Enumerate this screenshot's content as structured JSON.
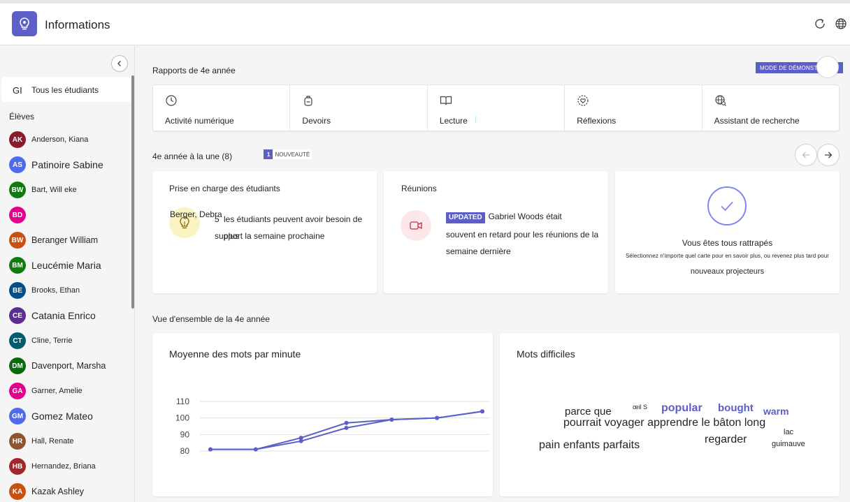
{
  "header": {
    "title": "Informations",
    "app_icon": "lightbulb-icon",
    "refresh_icon": "refresh-icon",
    "globe_icon": "globe-icon"
  },
  "sidebar": {
    "all_students": {
      "initials": "GI",
      "label": "Tous les étudiants"
    },
    "section_label": "Élèves",
    "students": [
      {
        "initials": "AK",
        "name": "Anderson, Kiana",
        "color": "#8b1a2b",
        "size": "small"
      },
      {
        "initials": "AS",
        "name": "Patinoire Sabine",
        "color": "#4f6bed",
        "size": "large"
      },
      {
        "initials": "BW",
        "name": "Bart, Will eke",
        "color": "#107c10",
        "size": "small"
      },
      {
        "initials": "BD",
        "name": "",
        "color": "#e3008c",
        "size": "small"
      },
      {
        "initials": "BW",
        "name": "Beranger William",
        "color": "#ca5010",
        "size": "medium"
      },
      {
        "initials": "BM",
        "name": "Leucémie Maria",
        "color": "#107c10",
        "size": "large"
      },
      {
        "initials": "BE",
        "name": "Brooks, Ethan",
        "color": "#004e8c",
        "size": "small"
      },
      {
        "initials": "CE",
        "name": "Catania Enrico",
        "color": "#5c2e91",
        "size": "large"
      },
      {
        "initials": "CT",
        "name": "Cline, Terrie",
        "color": "#005b70",
        "size": "small"
      },
      {
        "initials": "DM",
        "name": "Davenport, Marsha",
        "color": "#0b6a0b",
        "size": "medium"
      },
      {
        "initials": "GA",
        "name": "Garner, Amelie",
        "color": "#e3008c",
        "size": "small"
      },
      {
        "initials": "GM",
        "name": "Gomez Mateo",
        "color": "#4f6bed",
        "size": "large"
      },
      {
        "initials": "HR",
        "name": "Hall, Renate",
        "color": "#8e562e",
        "size": "small"
      },
      {
        "initials": "HB",
        "name": "Hernandez, Briana",
        "color": "#a4262c",
        "size": "small"
      },
      {
        "initials": "KA",
        "name": "Kazak Ashley",
        "color": "#ca5010",
        "size": "medium"
      }
    ]
  },
  "reports": {
    "title": "Rapports de 4e année",
    "demo_badge": "MODE DE DÉMONSTRATION",
    "items": [
      {
        "label": "Activité numérique",
        "icon": "clock-icon"
      },
      {
        "label": "Devoirs",
        "icon": "backpack-icon"
      },
      {
        "label": "Lecture",
        "icon": "book-icon"
      },
      {
        "label": "Réflexions",
        "icon": "heart-icon"
      },
      {
        "label": "Assistant de recherche",
        "icon": "globe-search-icon"
      }
    ]
  },
  "spotlight": {
    "title": "4e année à la une (8)",
    "new_count": "1",
    "new_label": "NOUVEAUTÉ",
    "cards": {
      "support": {
        "title": "Prise en charge des étudiants",
        "student": "Berger, Debra",
        "count": "5",
        "text1": "les étudiants peuvent avoir besoin de plus",
        "text2": "support la semaine prochaine"
      },
      "meetings": {
        "title": "Réunions",
        "badge": "UPDATED",
        "text1": "Gabriel Woods était",
        "text2": "souvent en retard pour les réunions de la semaine dernière"
      },
      "caught_up": {
        "title": "Vous êtes tous rattrapés",
        "sub1": "Sélectionnez n'importe quel carte pour en savoir plus, ou revenez plus tard pour",
        "sub2": "nouveaux projecteurs"
      }
    }
  },
  "overview": {
    "title": "Vue d'ensemble de la 4e année",
    "wpm_title": "Moyenne des mots par minute",
    "difficult_title": "Mots difficiles",
    "words": [
      {
        "text": "parce que",
        "size": 15,
        "color": "#242424",
        "bold": false
      },
      {
        "text": "œil S",
        "size": 9,
        "color": "#242424",
        "bold": false
      },
      {
        "text": "popular",
        "size": 16,
        "color": "#5b5fc7",
        "bold": true
      },
      {
        "text": "bought",
        "size": 15,
        "color": "#5b5fc7",
        "bold": true
      },
      {
        "text": "warm",
        "size": 14,
        "color": "#5b5fc7",
        "bold": true
      },
      {
        "text": "pourrait voyager apprendre le bâton long",
        "size": 16,
        "color": "#242424",
        "bold": false
      },
      {
        "text": "lac",
        "size": 11,
        "color": "#242424",
        "bold": false
      },
      {
        "text": "regarder",
        "size": 16,
        "color": "#242424",
        "bold": false
      },
      {
        "text": "pain enfants parfaits",
        "size": 16,
        "color": "#242424",
        "bold": false
      },
      {
        "text": "guimauve",
        "size": 11,
        "color": "#242424",
        "bold": false
      }
    ]
  },
  "chart_data": {
    "type": "line",
    "title": "Moyenne des mots par minute",
    "yticks": [
      80,
      90,
      100,
      110
    ],
    "ylim": [
      78,
      112
    ],
    "series": [
      {
        "values": [
          81,
          81,
          88,
          97,
          99,
          100,
          104
        ]
      },
      {
        "values": [
          81,
          81,
          86,
          94,
          99,
          100,
          104
        ]
      }
    ],
    "color": "#5b5fc7",
    "grid": true
  }
}
